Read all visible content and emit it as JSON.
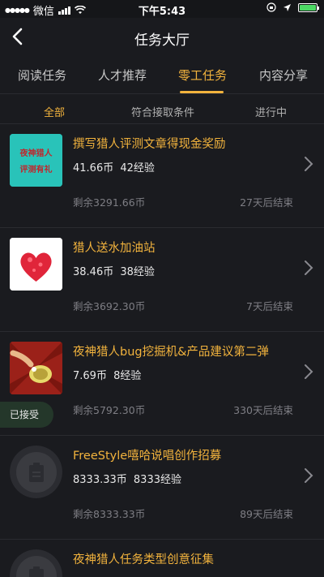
{
  "status_bar": {
    "carrier": "微信",
    "time": "下午5:43"
  },
  "header": {
    "title": "任务大厅"
  },
  "tabs": [
    {
      "label": "阅读任务"
    },
    {
      "label": "人才推荐"
    },
    {
      "label": "零工任务"
    },
    {
      "label": "内容分享"
    }
  ],
  "filters": [
    {
      "label": "全部"
    },
    {
      "label": "符合接取条件"
    },
    {
      "label": "进行中"
    }
  ],
  "tasks": [
    {
      "title": "撰写猎人评测文章得现金奖励",
      "coins": "41.66币",
      "exp": "42经验",
      "remain": "剩余3291.66币",
      "deadline": "27天后结束",
      "thumb_text_1": "夜神猎人",
      "thumb_text_2": "评测有礼"
    },
    {
      "title": "猎人送水加油站",
      "coins": "38.46币",
      "exp": "38经验",
      "remain": "剩余3692.30币",
      "deadline": "7天后结束"
    },
    {
      "title": "夜神猎人bug挖掘机&产品建议第二弹",
      "coins": "7.69币",
      "exp": "8经验",
      "remain": "剩余5792.30币",
      "deadline": "330天后结束",
      "badge": "已接受"
    },
    {
      "title": "FreeStyle嘻哈说唱创作招募",
      "coins": "8333.33币",
      "exp": "8333经验",
      "remain": "剩余8333.33币",
      "deadline": "89天后结束"
    },
    {
      "title": "夜神猎人任务类型创意征集"
    }
  ],
  "colors": {
    "accent": "#f2b33d",
    "background": "#1a1b1f",
    "muted": "#7e7e84"
  }
}
